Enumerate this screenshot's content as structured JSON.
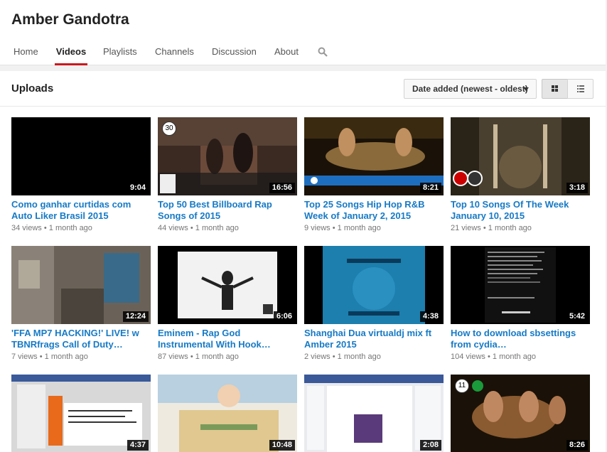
{
  "channel": {
    "title": "Amber Gandotra"
  },
  "tabs": [
    {
      "label": "Home"
    },
    {
      "label": "Videos"
    },
    {
      "label": "Playlists"
    },
    {
      "label": "Channels"
    },
    {
      "label": "Discussion"
    },
    {
      "label": "About"
    }
  ],
  "uploads": {
    "title": "Uploads",
    "sort_label": "Date added (newest - oldest)"
  },
  "colors": {
    "accent_red": "#cc181e",
    "link_blue": "#167ac6"
  },
  "videos": [
    {
      "title": "Como ganhar curtidas com Auto Liker Brasil 2015",
      "duration": "9:04",
      "views": "34 views",
      "age": "1 month ago"
    },
    {
      "title": "Top 50 Best Billboard Rap Songs of 2015",
      "duration": "16:56",
      "views": "44 views",
      "age": "1 month ago",
      "badge": "30"
    },
    {
      "title": "Top 25 Songs Hip Hop R&B Week of January 2, 2015",
      "duration": "8:21",
      "views": "9 views",
      "age": "1 month ago"
    },
    {
      "title": "Top 10 Songs Of The Week January 10, 2015",
      "duration": "3:18",
      "views": "21 views",
      "age": "1 month ago"
    },
    {
      "title": "'FFA MP7 HACKING!' LIVE! w TBNRfrags Call of Duty…",
      "duration": "12:24",
      "views": "7 views",
      "age": "1 month ago"
    },
    {
      "title": "Eminem - Rap God Instrumental With Hook…",
      "duration": "6:06",
      "views": "87 views",
      "age": "1 month ago"
    },
    {
      "title": "Shanghai Dua virtualdj mix ft Amber 2015",
      "duration": "4:38",
      "views": "2 views",
      "age": "1 month ago"
    },
    {
      "title": "How to download sbsettings from cydia…",
      "duration": "5:42",
      "views": "104 views",
      "age": "1 month ago"
    },
    {
      "title": "",
      "duration": "4:37",
      "views": "",
      "age": ""
    },
    {
      "title": "",
      "duration": "10:48",
      "views": "",
      "age": ""
    },
    {
      "title": "",
      "duration": "2:08",
      "views": "",
      "age": ""
    },
    {
      "title": "",
      "duration": "8:26",
      "views": "",
      "age": "",
      "badge": "11"
    }
  ],
  "icons": {
    "search": "search-icon",
    "grid": "grid-view-icon",
    "list": "list-view-icon"
  }
}
